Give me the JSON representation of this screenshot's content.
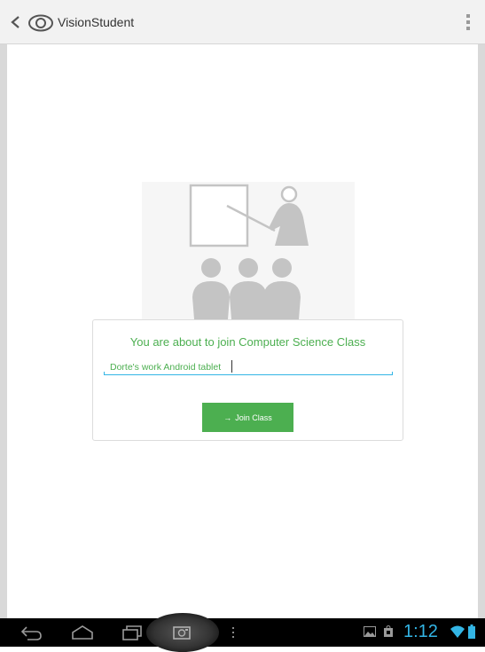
{
  "app": {
    "title": "VisionStudent"
  },
  "join": {
    "message": "You are about to join Computer Science Class",
    "device_name": "Dorte's work Android tablet",
    "button_label": "Join Class"
  },
  "statusbar": {
    "time": "1:12"
  },
  "colors": {
    "accent_green": "#4caf50",
    "holo_blue": "#33b5e5"
  },
  "icons": {
    "back": "back-icon",
    "app": "eye-icon",
    "overflow": "overflow-menu-icon"
  }
}
